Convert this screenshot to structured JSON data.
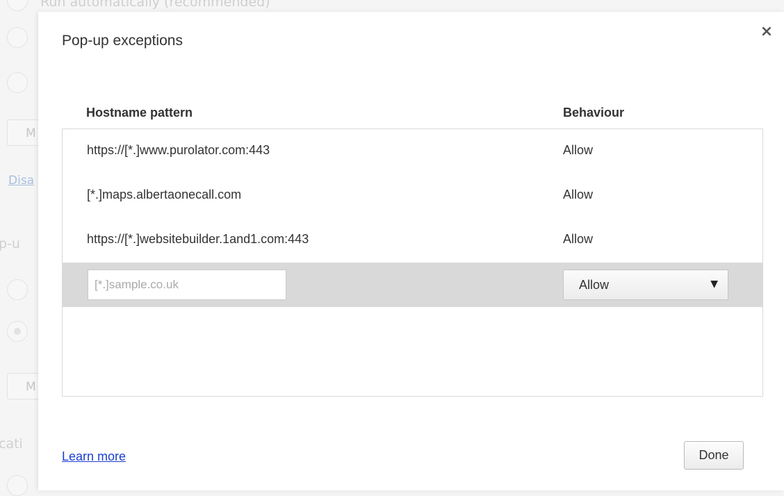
{
  "background": {
    "top_text": "Run automatically (recommended)",
    "button_fragment_1": "M",
    "link_fragment": "Disa",
    "section_fragment_1": "p-u",
    "button_fragment_2": "M",
    "section_fragment_2": "cati"
  },
  "dialog": {
    "title": "Pop-up exceptions",
    "close_glyph": "×",
    "columns": {
      "hostname": "Hostname pattern",
      "behaviour": "Behaviour"
    },
    "rows": [
      {
        "host": "https://[*.]www.purolator.com:443",
        "behaviour": "Allow"
      },
      {
        "host": "[*.]maps.albertaonecall.com",
        "behaviour": "Allow"
      },
      {
        "host": "https://[*.]websitebuilder.1and1.com:443",
        "behaviour": "Allow"
      }
    ],
    "new_entry": {
      "placeholder": "[*.]sample.co.uk",
      "value": "",
      "behaviour_selected": "Allow"
    },
    "learn_more": "Learn more",
    "done_label": "Done"
  },
  "icons": {
    "close": "close-icon",
    "dropdown": "chevron-down-icon"
  }
}
